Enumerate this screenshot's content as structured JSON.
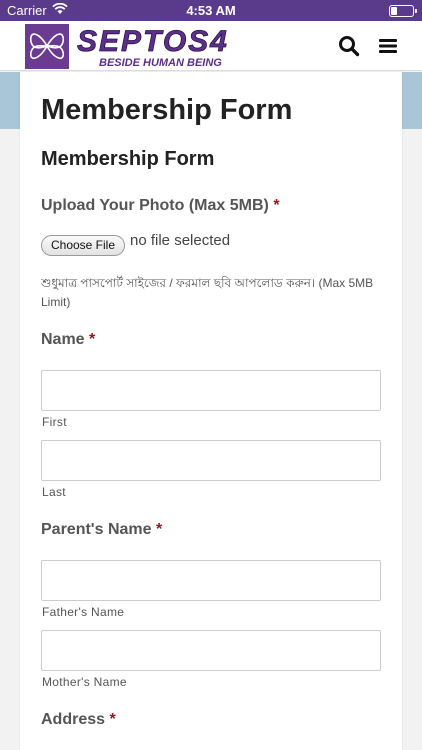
{
  "status_bar": {
    "carrier": "Carrier",
    "time": "4:53 AM"
  },
  "header": {
    "logo_text": "SEPTOS4",
    "logo_tagline": "BESIDE HUMAN BEING",
    "brand_color": "#5a3a8a",
    "icons": [
      "search-icon",
      "hamburger-menu-icon"
    ]
  },
  "page": {
    "title": "Membership Form",
    "form_title": "Membership Form"
  },
  "form": {
    "required_marker": "*",
    "photo": {
      "label": "Upload Your Photo (Max 5MB)",
      "button_label": "Choose File",
      "status": "no file selected",
      "help": "শুধুমাত্র পাসপোর্ট সাইজের / ফরমাল ছবি আপলোড করুন। (Max 5MB Limit)"
    },
    "name": {
      "label": "Name",
      "first_sublabel": "First",
      "last_sublabel": "Last"
    },
    "parents_name": {
      "label": "Parent's Name",
      "father_sublabel": "Father's Name",
      "mother_sublabel": "Mother's Name"
    },
    "address": {
      "label": "Address"
    }
  },
  "colors": {
    "status_bar_bg": "#5a3a8a",
    "hero_bg": "#a9c6d8",
    "required_marker": "#8b1a1a"
  }
}
